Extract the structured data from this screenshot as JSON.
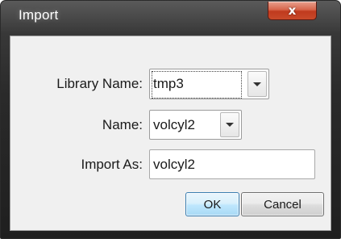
{
  "window": {
    "title": "Import",
    "close_glyph": "x"
  },
  "form": {
    "library": {
      "label": "Library Name:",
      "value": "tmp3",
      "icon": "chevron-down-icon"
    },
    "name": {
      "label": "Name:",
      "value": "volcyl2",
      "icon": "chevron-down-icon"
    },
    "import_as": {
      "label": "Import As:",
      "value": "volcyl2"
    }
  },
  "buttons": {
    "ok": "OK",
    "cancel": "Cancel"
  },
  "colors": {
    "title_bar": "#2a2a2a",
    "close_button": "#c84a2a",
    "client_bg": "#f0f0f0",
    "ok_button_border": "#3c7fb1"
  }
}
